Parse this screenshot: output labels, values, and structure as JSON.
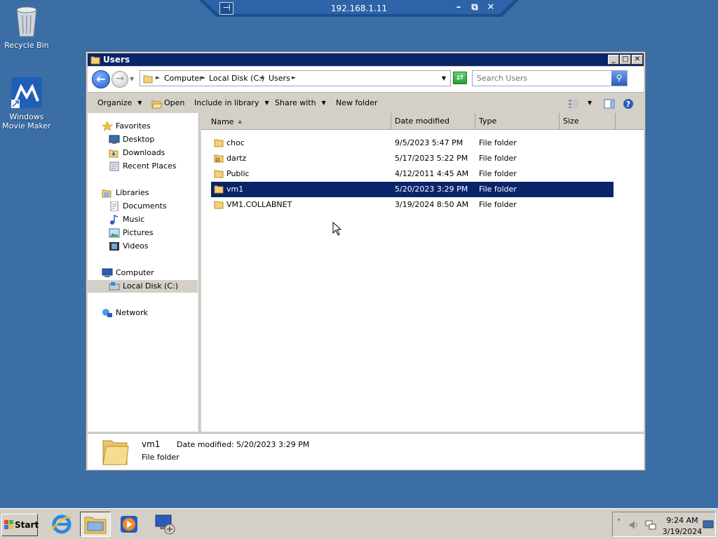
{
  "desktop": {
    "icons": [
      {
        "label": "Recycle Bin"
      },
      {
        "label": "Windows Movie Maker"
      }
    ]
  },
  "rdp": {
    "title": "192.168.1.11",
    "pin_glyph": "⊣",
    "minimize_glyph": "–",
    "restore_glyph": "⧉",
    "close_glyph": "✕"
  },
  "window": {
    "title": "Users",
    "minimize_glyph": "_",
    "maximize_glyph": "□",
    "close_glyph": "✕"
  },
  "address": {
    "crumbs": [
      "Computer",
      "Local Disk (C:)",
      "Users"
    ]
  },
  "search": {
    "placeholder": "Search Users"
  },
  "commands": {
    "organize": "Organize",
    "open": "Open",
    "include_in_library": "Include in library",
    "share_with": "Share with",
    "new_folder": "New folder"
  },
  "nav": {
    "favorites": "Favorites",
    "desktop": "Desktop",
    "downloads": "Downloads",
    "recent_places": "Recent Places",
    "libraries": "Libraries",
    "documents": "Documents",
    "music": "Music",
    "pictures": "Pictures",
    "videos": "Videos",
    "computer": "Computer",
    "local_disk": "Local Disk (C:)",
    "network": "Network"
  },
  "columns": {
    "name": "Name",
    "date_modified": "Date modified",
    "type": "Type",
    "size": "Size"
  },
  "files": [
    {
      "name": "choc",
      "date": "9/5/2023 5:47 PM",
      "type": "File folder"
    },
    {
      "name": "dartz",
      "date": "5/17/2023 5:22 PM",
      "type": "File folder"
    },
    {
      "name": "Public",
      "date": "4/12/2011 4:45 AM",
      "type": "File folder"
    },
    {
      "name": "vm1",
      "date": "5/20/2023 3:29 PM",
      "type": "File folder"
    },
    {
      "name": "VM1.COLLABNET",
      "date": "3/19/2024 8:50 AM",
      "type": "File folder"
    }
  ],
  "details": {
    "name": "vm1",
    "date_modified": "Date modified:  5/20/2023 3:29 PM",
    "type": "File folder"
  },
  "taskbar": {
    "start": "Start",
    "time": "9:24 AM",
    "date": "3/19/2024"
  },
  "colors": {
    "desktop": "#3a6ea5",
    "selection": "#0a246a",
    "chrome": "#d4d0c8"
  }
}
